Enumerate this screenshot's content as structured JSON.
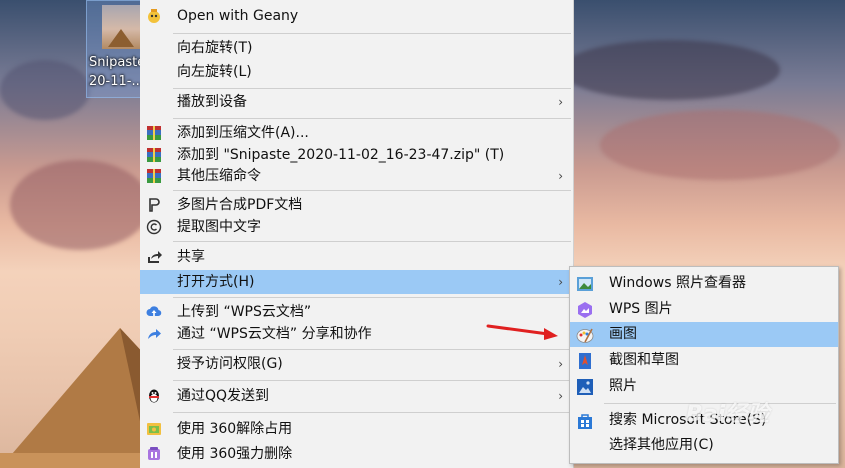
{
  "desktop_icon": {
    "label_line1": "Snipaste",
    "label_line2": "20-11-..."
  },
  "menu": [
    {
      "label": "Open with Geany",
      "icon": "geany-icon"
    },
    {
      "label": "向右旋转(T)"
    },
    {
      "label": "向左旋转(L)"
    },
    {
      "label": "播放到设备",
      "submenu": true
    },
    {
      "label": "添加到压缩文件(A)...",
      "icon": "archive-icon"
    },
    {
      "label": "添加到 \"Snipaste_2020-11-02_16-23-47.zip\" (T)",
      "icon": "archive-icon"
    },
    {
      "label": "其他压缩命令",
      "icon": "archive-icon",
      "submenu": true
    },
    {
      "label": "多图片合成PDF文档",
      "icon": "pdf-merge-icon"
    },
    {
      "label": "提取图中文字",
      "icon": "ocr-icon"
    },
    {
      "label": "共享",
      "icon": "share-icon"
    },
    {
      "label": "打开方式(H)",
      "submenu": true,
      "highlighted": true
    },
    {
      "label": "上传到 “WPS云文档”",
      "icon": "cloud-upload-icon"
    },
    {
      "label": "通过 “WPS云文档” 分享和协作",
      "icon": "wps-share-icon"
    },
    {
      "label": "授予访问权限(G)",
      "submenu": true
    },
    {
      "label": "通过QQ发送到",
      "icon": "qq-icon",
      "submenu": true
    },
    {
      "label": "使用 360解除占用",
      "icon": "360-unlock-icon"
    },
    {
      "label": "使用 360强力删除",
      "icon": "360-delete-icon"
    }
  ],
  "submenu": [
    {
      "label": "Windows 照片查看器",
      "icon": "photo-viewer-icon"
    },
    {
      "label": "WPS 图片",
      "icon": "wps-picture-icon"
    },
    {
      "label": "画图",
      "icon": "paint-icon",
      "highlighted": true
    },
    {
      "label": "截图和草图",
      "icon": "snip-sketch-icon"
    },
    {
      "label": "照片",
      "icon": "photos-icon"
    },
    {
      "label": "搜索 Microsoft Store(S)",
      "icon": "store-icon"
    },
    {
      "label": "选择其他应用(C)"
    }
  ],
  "submenu_arrow_glyph": "›",
  "watermark": "Bai经验",
  "colors": {
    "highlight": "#9bc9f5",
    "menu_bg": "#f2f2f2",
    "annotation_arrow": "#e02020"
  }
}
